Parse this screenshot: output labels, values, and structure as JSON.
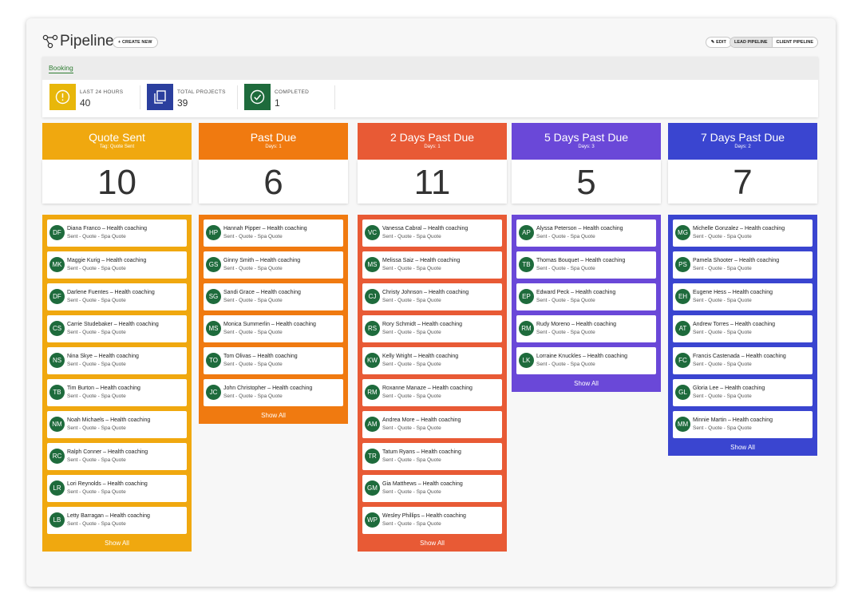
{
  "header": {
    "title": "Pipeline",
    "create_label": "+ CREATE NEW",
    "edit_label": "EDIT",
    "lead_pipeline_label": "LEAD PIPELINE",
    "client_pipeline_label": "CLIENT PIPELINE"
  },
  "booking_tab": "Booking",
  "stats": [
    {
      "label": "LAST 24 HOURS",
      "value": "40",
      "color": "#e8b70a",
      "icon": "alert-icon"
    },
    {
      "label": "TOTAL PROJECTS",
      "value": "39",
      "color": "#2b3f9e",
      "icon": "copy-icon"
    },
    {
      "label": "COMPLETED",
      "value": "1",
      "color": "#1e6b3c",
      "icon": "check-icon"
    }
  ],
  "show_all_label": "Show All",
  "columns": [
    {
      "title": "Quote Sent",
      "subtitle": "Tag: Quote Sent",
      "count": "10",
      "color": "#f0a80f",
      "cards": [
        {
          "initials": "DF",
          "name": "Diana Franco – Health coaching",
          "meta": "Sent - Quote - Spa Quote"
        },
        {
          "initials": "MK",
          "name": "Maggie Kurig – Health coaching",
          "meta": "Sent - Quote - Spa Quote"
        },
        {
          "initials": "DF",
          "name": "Darlene Fuentes – Health coaching",
          "meta": "Sent - Quote - Spa Quote"
        },
        {
          "initials": "CS",
          "name": "Carrie Studebaker – Health coaching",
          "meta": "Sent - Quote - Spa Quote"
        },
        {
          "initials": "NS",
          "name": "Nina Skye – Health coaching",
          "meta": "Sent - Quote - Spa Quote"
        },
        {
          "initials": "TB",
          "name": "Tim Burton – Health coaching",
          "meta": "Sent - Quote - Spa Quote"
        },
        {
          "initials": "NM",
          "name": "Noah Michaels – Health coaching",
          "meta": "Sent - Quote - Spa Quote"
        },
        {
          "initials": "RC",
          "name": "Ralph Conner – Health coaching",
          "meta": "Sent - Quote - Spa Quote"
        },
        {
          "initials": "LR",
          "name": "Lori Reynolds – Health coaching",
          "meta": "Sent - Quote - Spa Quote"
        },
        {
          "initials": "LB",
          "name": "Letty Barragan – Health coaching",
          "meta": "Sent - Quote - Spa Quote"
        }
      ]
    },
    {
      "title": "Past Due",
      "subtitle": "Days: 1",
      "count": "6",
      "color": "#f07a10",
      "cards": [
        {
          "initials": "HP",
          "name": "Hannah Pipper – Health coaching",
          "meta": "Sent - Quote - Spa Quote"
        },
        {
          "initials": "GS",
          "name": "Ginny Smith – Health coaching",
          "meta": "Sent - Quote - Spa Quote"
        },
        {
          "initials": "SG",
          "name": "Sandi Grace – Health coaching",
          "meta": "Sent - Quote - Spa Quote"
        },
        {
          "initials": "MS",
          "name": "Monica Summerlin – Health coaching",
          "meta": "Sent - Quote - Spa Quote"
        },
        {
          "initials": "TO",
          "name": "Tom Olivas – Health coaching",
          "meta": "Sent - Quote - Spa Quote"
        },
        {
          "initials": "JC",
          "name": "John Christopher – Health coaching",
          "meta": "Sent - Quote - Spa Quote"
        }
      ]
    },
    {
      "title": "2 Days Past Due",
      "subtitle": "Days: 1",
      "count": "11",
      "color": "#e85a35",
      "cards": [
        {
          "initials": "VC",
          "name": "Vanessa Cabral – Health coaching",
          "meta": "Sent - Quote - Spa Quote"
        },
        {
          "initials": "MS",
          "name": "Melissa Saiz – Health coaching",
          "meta": "Sent - Quote - Spa Quote"
        },
        {
          "initials": "CJ",
          "name": "Christy Johnson – Health coaching",
          "meta": "Sent - Quote - Spa Quote"
        },
        {
          "initials": "RS",
          "name": "Rory Schmidt – Health coaching",
          "meta": "Sent - Quote - Spa Quote"
        },
        {
          "initials": "KW",
          "name": "Kelly Wright – Health coaching",
          "meta": "Sent - Quote - Spa Quote"
        },
        {
          "initials": "RM",
          "name": "Roxanne Manaze – Health coaching",
          "meta": "Sent - Quote - Spa Quote"
        },
        {
          "initials": "AM",
          "name": "Andrea More – Health coaching",
          "meta": "Sent - Quote - Spa Quote"
        },
        {
          "initials": "TR",
          "name": "Tatum Ryans – Health coaching",
          "meta": "Sent - Quote - Spa Quote"
        },
        {
          "initials": "GM",
          "name": "Gia Matthews – Health coaching",
          "meta": "Sent - Quote - Spa Quote"
        },
        {
          "initials": "WP",
          "name": "Wesley Phillips – Health coaching",
          "meta": "Sent - Quote - Spa Quote"
        }
      ]
    },
    {
      "title": "5 Days Past Due",
      "subtitle": "Days: 3",
      "count": "5",
      "color": "#6a48d8",
      "cards": [
        {
          "initials": "AP",
          "name": "Alyssa Peterson – Health coaching",
          "meta": "Sent - Quote - Spa Quote"
        },
        {
          "initials": "TB",
          "name": "Thomas Bouquet – Health coaching",
          "meta": "Sent - Quote - Spa Quote"
        },
        {
          "initials": "EP",
          "name": "Edward Peck – Health coaching",
          "meta": "Sent - Quote - Spa Quote"
        },
        {
          "initials": "RM",
          "name": "Rudy Moreno – Health coaching",
          "meta": "Sent - Quote - Spa Quote"
        },
        {
          "initials": "LK",
          "name": "Lorraine Knuckles – Health coaching",
          "meta": "Sent - Quote - Spa Quote"
        }
      ]
    },
    {
      "title": "7 Days Past Due",
      "subtitle": "Days: 2",
      "count": "7",
      "color": "#3a45d0",
      "cards": [
        {
          "initials": "MG",
          "name": "Michelle Gonzalez – Health coaching",
          "meta": "Sent - Quote - Spa Quote"
        },
        {
          "initials": "PS",
          "name": "Pamela Shooter – Health coaching",
          "meta": "Sent - Quote - Spa Quote"
        },
        {
          "initials": "EH",
          "name": "Eugene Hess – Health coaching",
          "meta": "Sent - Quote - Spa Quote"
        },
        {
          "initials": "AT",
          "name": "Andrew Torres – Health coaching",
          "meta": "Sent - Quote - Spa Quote"
        },
        {
          "initials": "FC",
          "name": "Francis Castenada – Health coaching",
          "meta": "Sent - Quote - Spa Quote"
        },
        {
          "initials": "GL",
          "name": "Gloria Lee – Health coaching",
          "meta": "Sent - Quote - Spa Quote"
        },
        {
          "initials": "MM",
          "name": "Minnie Martin – Health coaching",
          "meta": "Sent - Quote - Spa Quote"
        }
      ]
    }
  ]
}
